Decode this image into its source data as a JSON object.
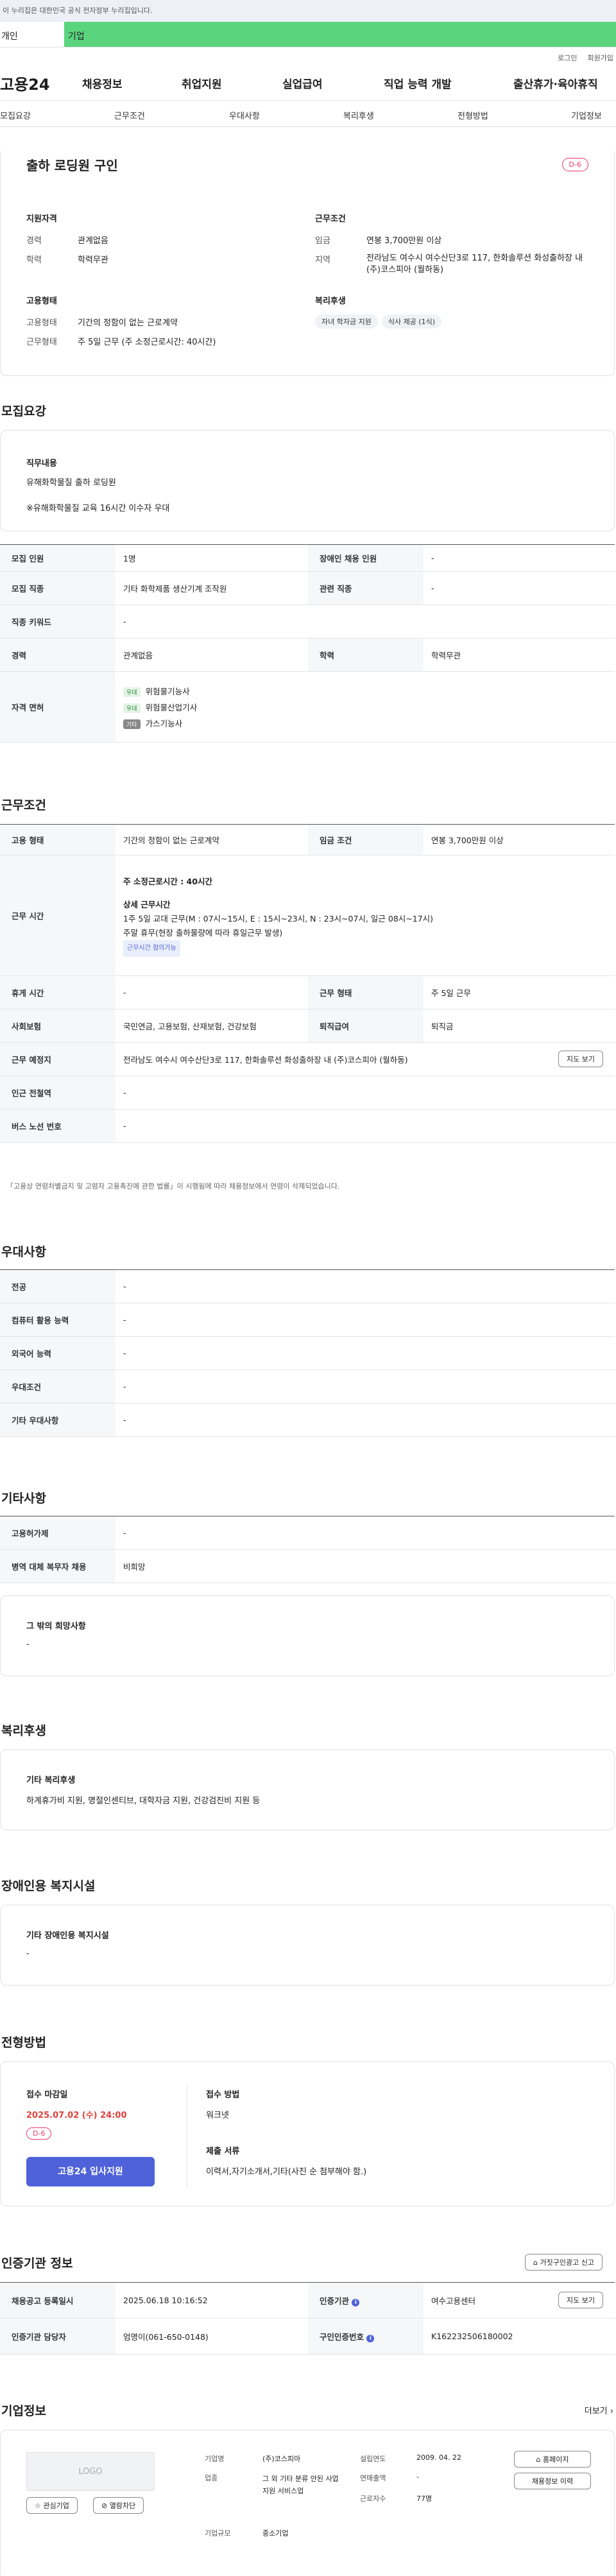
{
  "gov_banner": "이 누리집은 대한민국 공식 전자정부 누리집입니다.",
  "tabs": {
    "personal": "개인",
    "company": "기업"
  },
  "util": {
    "login": "로그인",
    "signup": "회원가입"
  },
  "gnb": {
    "logo": "고용24",
    "items": [
      "채용정보",
      "취업지원",
      "실업급여",
      "직업 능력 개발",
      "출산휴가·육아휴직"
    ]
  },
  "subnav": [
    "모집요강",
    "근무조건",
    "우대사항",
    "복리후생",
    "전형방법",
    "기업정보"
  ],
  "summary": {
    "title": "출하 로딩원 구인",
    "dday": "D-6",
    "qual_title": "지원자격",
    "career_k": "경력",
    "career_v": "관계없음",
    "edu_k": "학력",
    "edu_v": "학력무관",
    "cond_title": "근무조건",
    "wage_k": "임금",
    "wage_v": "연봉 3,700만원 이상",
    "region_k": "지역",
    "region_v": "전라남도 여수시 여수산단3로 117, 한화솔루션 화성출하장 내 (주)코스피아 (월하동)",
    "emp_title": "고용형태",
    "emptype_k": "고용형태",
    "emptype_v": "기간의 정함이 없는 근로계약",
    "worktype_k": "근무형태",
    "worktype_v": "주 5일 근무 (주 소정근로시간: 40시간)",
    "welfare_title": "복리후생",
    "welfare_tags": [
      "자녀 학자금 지원",
      "식사 제공 (1식)"
    ]
  },
  "recruit": {
    "title": "모집요강",
    "duty_title": "직무내용",
    "duty_line1": "유해화학물질 출하 로딩원",
    "duty_line2": "※유해화학물질 교육 16시간 이수자 우대",
    "rows": {
      "headcount_k": "모집 인원",
      "headcount_v": "1명",
      "disabled_k": "장애인 채용 인원",
      "disabled_v": "-",
      "job_k": "모집 직종",
      "job_v": "기타 화학제품 생산기계 조작원",
      "related_k": "관련 직종",
      "related_v": "-",
      "kw_k": "직종 키워드",
      "kw_v": "-",
      "career_k": "경력",
      "career_v": "관계없음",
      "edu_k": "학력",
      "edu_v": "학력무관",
      "lic_k": "자격 면허"
    },
    "licenses": [
      {
        "tag": "우대",
        "name": "위험물기능사"
      },
      {
        "tag": "우대",
        "name": "위험물산업기사"
      },
      {
        "tag": "기타",
        "name": "가스기능사"
      }
    ]
  },
  "work": {
    "title": "근무조건",
    "emp_k": "고용 형태",
    "emp_v": "기간의 정함이 없는 근로계약",
    "wage_k": "임금 조건",
    "wage_v": "연봉 3,700만원 이상",
    "time_k": "근무 시간",
    "weekly": "주 소정근로시간 : 40시간",
    "detail_title": "상세 근무시간",
    "detail1": "1주 5일 교대 근무(M : 07시~15시, E : 15시~23시, N : 23시~07시, 일근 08시~17시)",
    "detail2": "주말 휴무(현장 출하물량에 따라 휴일근무 발생)",
    "chip": "근무시간 협의가능",
    "rest_k": "휴게 시간",
    "rest_v": "-",
    "form_k": "근무 형태",
    "form_v": "주 5일 근무",
    "ins_k": "사회보험",
    "ins_v": "국민연금, 고용보험, 산재보험, 건강보험",
    "ret_k": "퇴직급여",
    "ret_v": "퇴직금",
    "place_k": "근무 예정지",
    "place_v": "전라남도 여수시 여수산단3로 117, 한화솔루션 화성출하장 내 (주)코스피아 (월하동)",
    "map_btn": "지도 보기",
    "station_k": "인근 전철역",
    "station_v": "-",
    "bus_k": "버스 노선 번호",
    "bus_v": "-",
    "note": "「고용상 연령차별금지 및 고령자 고용촉진에 관한 법률」이 시행됨에 따라 채용정보에서 연령이 삭제되었습니다."
  },
  "pref": {
    "title": "우대사항",
    "rows": [
      [
        "전공",
        "-"
      ],
      [
        "컴퓨터 활용 능력",
        "-"
      ],
      [
        "외국어 능력",
        "-"
      ],
      [
        "우대조건",
        "-"
      ],
      [
        "기타 우대사항",
        "-"
      ]
    ]
  },
  "etc": {
    "title": "기타사항",
    "rows": [
      [
        "고용허가제",
        "-"
      ],
      [
        "병역 대체 복무자 채용",
        "비희망"
      ]
    ],
    "hope_title": "그 밖의 희망사항",
    "hope_v": "-"
  },
  "welfare": {
    "title": "복리후생",
    "box_title": "기타 복리후생",
    "box_v": "하계휴가비 지원, 명절인센티브, 대학자금 지원, 건강검진비 지원 등"
  },
  "disab": {
    "title": "장애인용 복지시설",
    "box_title": "기타 장애인용 복지시설",
    "box_v": "-"
  },
  "process": {
    "title": "전형방법",
    "deadline_title": "접수 마감일",
    "deadline_v": "2025.07.02 (수) 24:00",
    "dday": "D-6",
    "apply_btn": "고용24 입사지원",
    "method_title": "접수 방법",
    "method_v": "워크넷",
    "docs_title": "제출 서류",
    "docs_v": "이력서,자기소개서,기타(사진 순 첨부해야 함.)"
  },
  "agency": {
    "title": "인증기관 정보",
    "report_btn": "거짓구인광고 신고",
    "reg_k": "채용공고 등록일시",
    "reg_v": "2025.06.18 10:16:52",
    "org_k": "인증기관",
    "org_v": "여수고용센터",
    "map_btn": "지도 보기",
    "mgr_k": "인증기관 담당자",
    "mgr_v": "엄명이(061-650-0148)",
    "no_k": "구인인증번호",
    "no_v": "K162232506180002"
  },
  "company": {
    "title": "기업정보",
    "more": "더보기",
    "logo": "LOGO",
    "fav_btn": "관심기업",
    "block_btn": "열람차단",
    "name_k": "기업명",
    "name_v": "(주)코스피아",
    "ind_k": "업종",
    "ind_v": "그 외 기타 분류 안된 사업지원 서비스업",
    "size_k": "기업규모",
    "size_v": "중소기업",
    "est_k": "설립연도",
    "est_v": "2009. 04. 22",
    "sales_k": "연매출액",
    "sales_v": "-",
    "emp_k": "근로자수",
    "emp_v": "77명",
    "home_btn": "홈페이지",
    "jobs_btn": "채용정보 이력"
  }
}
